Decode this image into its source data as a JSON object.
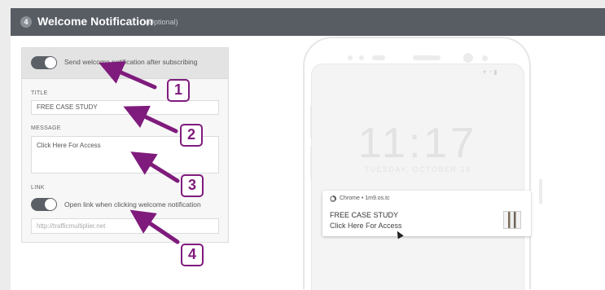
{
  "header": {
    "step_number": "4",
    "title": "Welcome Notification",
    "optional_label": "(Optional)"
  },
  "form": {
    "send_toggle_label": "Send welcome notification after subscribing",
    "title_label": "TITLE",
    "title_value": "FREE CASE STUDY",
    "message_label": "MESSAGE",
    "message_value": "Click Here For Access",
    "link_label": "LINK",
    "link_toggle_label": "Open link when clicking welcome notification",
    "link_placeholder": "http://trafficmultiplier.net"
  },
  "preview": {
    "time": "11:17",
    "date": "TUESDAY, OCTOBER 14",
    "notification": {
      "source": "Chrome • 1m9.os.tc",
      "title": "FREE CASE STUDY",
      "body": "Click Here For Access"
    }
  },
  "annotations": {
    "badges": [
      "1",
      "2",
      "3",
      "4"
    ],
    "color": "#7f1b7c"
  },
  "colors": {
    "header_bg": "#585d64",
    "toggle_on": "#5b6067"
  }
}
